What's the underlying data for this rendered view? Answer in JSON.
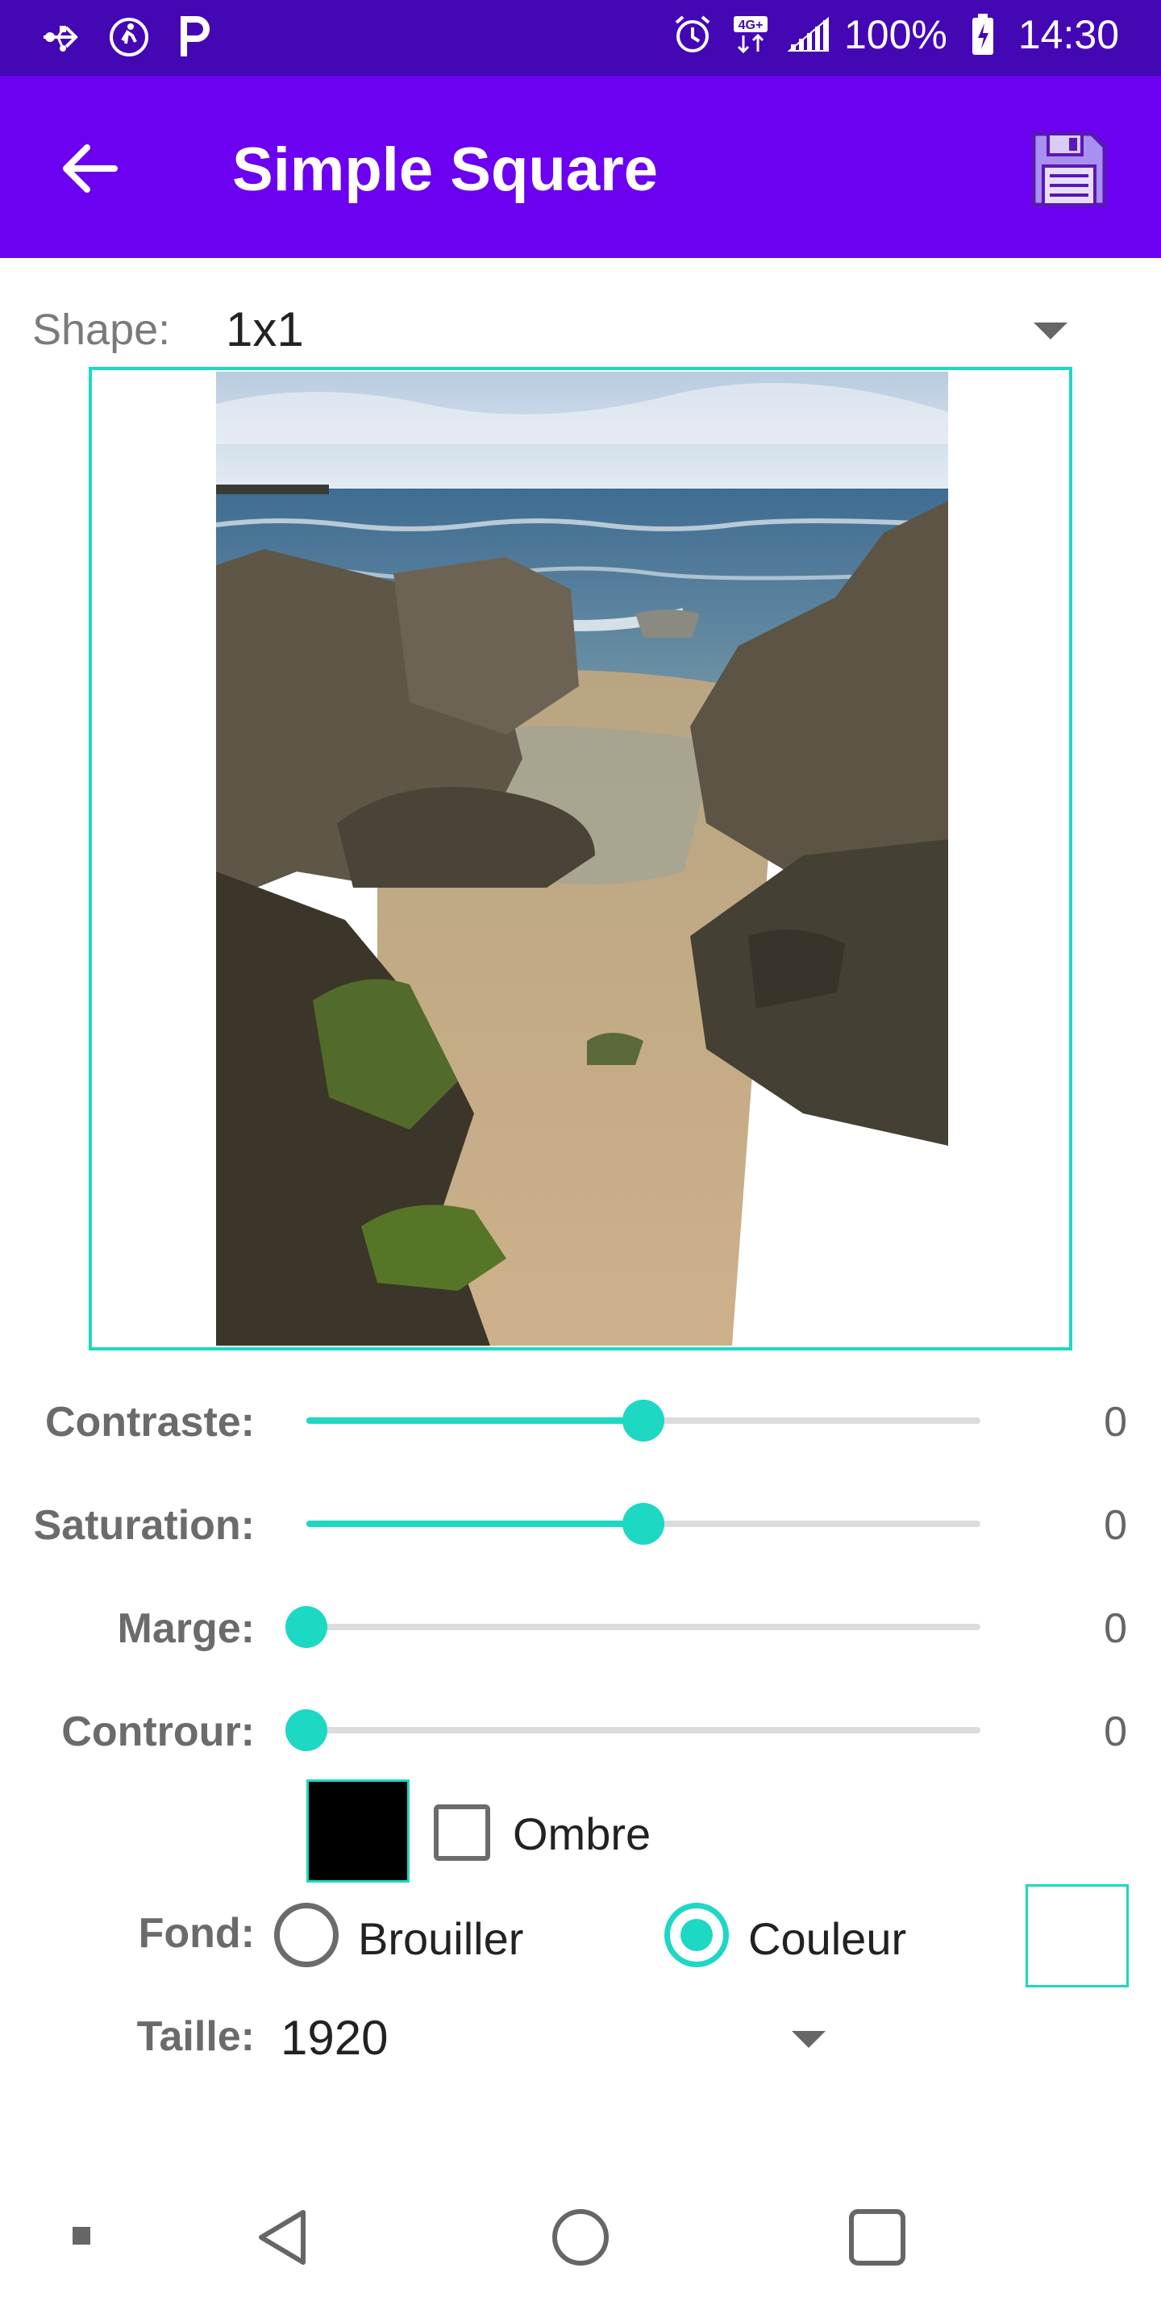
{
  "status_bar": {
    "icons_left": [
      "usb-icon",
      "activity-icon",
      "parking-icon"
    ],
    "icons_right": [
      "alarm-icon",
      "network-4g-icon",
      "signal-icon"
    ],
    "battery": "100%",
    "time": "14:30"
  },
  "app_bar": {
    "title": "Simple Square",
    "back_icon": "arrow-left-icon",
    "save_icon": "save-icon"
  },
  "shape": {
    "label": "Shape:",
    "value": "1x1"
  },
  "sliders": [
    {
      "label": "Contraste:",
      "value": "0",
      "position": 0.5
    },
    {
      "label": "Saturation:",
      "value": "0",
      "position": 0.5
    },
    {
      "label": "Marge:",
      "value": "0",
      "position": 0.0
    },
    {
      "label": "Controur:",
      "value": "0",
      "position": 0.0
    }
  ],
  "shadow": {
    "color": "#000000",
    "label": "Ombre",
    "checked": false
  },
  "background": {
    "label": "Fond:",
    "options": [
      {
        "label": "Brouiller",
        "selected": false
      },
      {
        "label": "Couleur",
        "selected": true
      }
    ],
    "color": "#ffffff"
  },
  "size": {
    "label": "Taille:",
    "value": "1920"
  },
  "nav_bar": {
    "icons": [
      "dot-icon",
      "back-triangle-icon",
      "home-circle-icon",
      "recents-square-icon"
    ]
  },
  "colors": {
    "status_bar": "#4407b4",
    "app_bar": "#6c00f0",
    "accent": "#1dd8c3"
  }
}
